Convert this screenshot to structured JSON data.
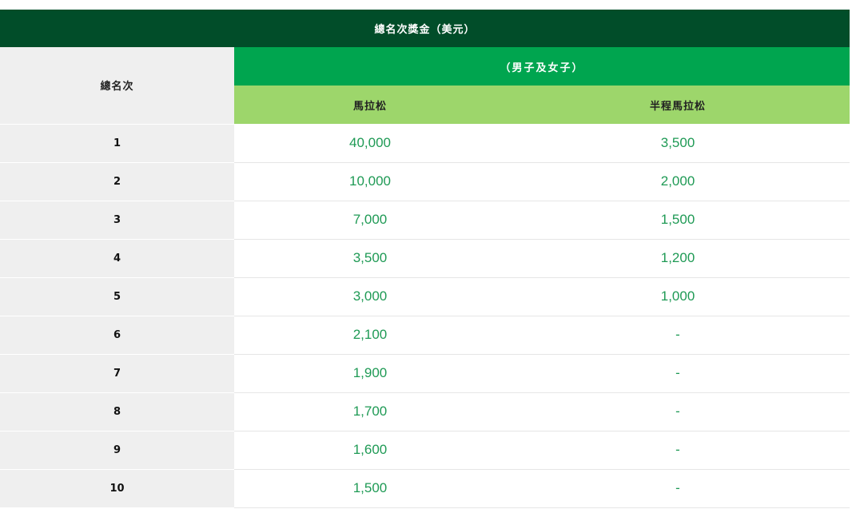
{
  "table": {
    "title": "總名次獎金（美元）",
    "rank_header": "總名次",
    "group_header": "（男子及女子）",
    "columns": [
      "馬拉松",
      "半程馬拉松"
    ],
    "rows": [
      {
        "rank": "1",
        "marathon": "40,000",
        "half": "3,500"
      },
      {
        "rank": "2",
        "marathon": "10,000",
        "half": "2,000"
      },
      {
        "rank": "3",
        "marathon": "7,000",
        "half": "1,500"
      },
      {
        "rank": "4",
        "marathon": "3,500",
        "half": "1,200"
      },
      {
        "rank": "5",
        "marathon": "3,000",
        "half": "1,000"
      },
      {
        "rank": "6",
        "marathon": "2,100",
        "half": "-"
      },
      {
        "rank": "7",
        "marathon": "1,900",
        "half": "-"
      },
      {
        "rank": "8",
        "marathon": "1,700",
        "half": "-"
      },
      {
        "rank": "9",
        "marathon": "1,600",
        "half": "-"
      },
      {
        "rank": "10",
        "marathon": "1,500",
        "half": "-"
      }
    ]
  },
  "colors": {
    "title_bg": "#014d29",
    "group_bg": "#00a54f",
    "column_bg": "#9dd66b",
    "rank_bg": "#efefef",
    "amount_text": "#1f9a55"
  }
}
